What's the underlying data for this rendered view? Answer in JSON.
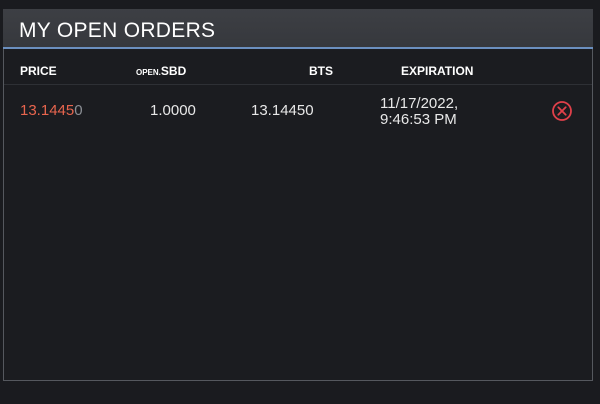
{
  "panel": {
    "title": "MY OPEN ORDERS"
  },
  "columns": {
    "price": "PRICE",
    "open_prefix": "OPEN.",
    "open_suffix": "SBD",
    "bts": "BTS",
    "expiration": "EXPIRATION"
  },
  "orders": [
    {
      "price_main": "13.1445",
      "price_tail": "0",
      "sbd": "1.0000",
      "bts": "13.14450",
      "expiration_date": "11/17/2022,",
      "expiration_time": "9:46:53 PM",
      "cancel_icon": "close-circle-icon"
    }
  ],
  "colors": {
    "price_accent": "#e8654e",
    "cancel_icon": "#e0404a",
    "header_underline": "#6b8fbf"
  }
}
